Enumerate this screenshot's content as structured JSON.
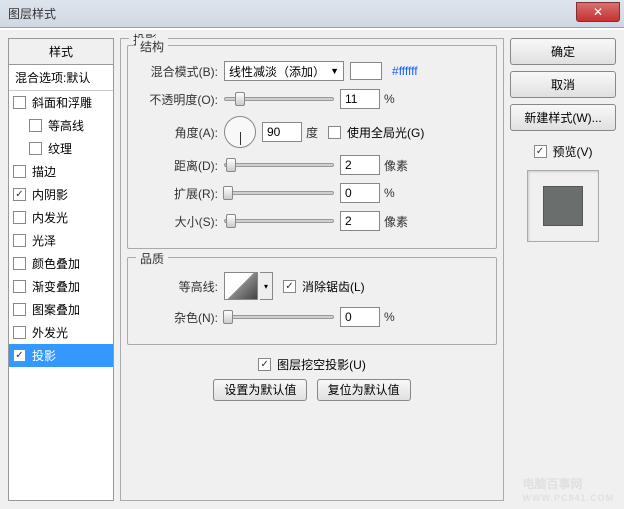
{
  "title": "图层样式",
  "styles_header": "样式",
  "blend_label": "混合选项:默认",
  "styles": [
    {
      "label": "斜面和浮雕",
      "checked": false,
      "indent": false
    },
    {
      "label": "等高线",
      "checked": false,
      "indent": true
    },
    {
      "label": "纹理",
      "checked": false,
      "indent": true
    },
    {
      "label": "描边",
      "checked": false,
      "indent": false
    },
    {
      "label": "内阴影",
      "checked": true,
      "indent": false
    },
    {
      "label": "内发光",
      "checked": false,
      "indent": false
    },
    {
      "label": "光泽",
      "checked": false,
      "indent": false
    },
    {
      "label": "颜色叠加",
      "checked": false,
      "indent": false
    },
    {
      "label": "渐变叠加",
      "checked": false,
      "indent": false
    },
    {
      "label": "图案叠加",
      "checked": false,
      "indent": false
    },
    {
      "label": "外发光",
      "checked": false,
      "indent": false
    },
    {
      "label": "投影",
      "checked": true,
      "indent": false,
      "selected": true
    }
  ],
  "panel": {
    "title": "投影",
    "structure_title": "结构",
    "blend_mode_label": "混合模式(B):",
    "blend_mode_value": "线性减淡（添加）",
    "color_hex": "#ffffff",
    "opacity_label": "不透明度(O):",
    "opacity_value": "11",
    "opacity_unit": "%",
    "angle_label": "角度(A):",
    "angle_value": "90",
    "angle_unit": "度",
    "global_light_label": "使用全局光(G)",
    "global_light_checked": false,
    "distance_label": "距离(D):",
    "distance_value": "2",
    "distance_unit": "像素",
    "spread_label": "扩展(R):",
    "spread_value": "0",
    "spread_unit": "%",
    "size_label": "大小(S):",
    "size_value": "2",
    "size_unit": "像素",
    "quality_title": "品质",
    "contour_label": "等高线:",
    "antialias_label": "消除锯齿(L)",
    "antialias_checked": true,
    "noise_label": "杂色(N):",
    "noise_value": "0",
    "noise_unit": "%",
    "knockout_label": "图层挖空投影(U)",
    "knockout_checked": true,
    "default_set": "设置为默认值",
    "default_reset": "复位为默认值"
  },
  "buttons": {
    "ok": "确定",
    "cancel": "取消",
    "new_style": "新建样式(W)...",
    "preview": "预览(V)"
  },
  "watermark": {
    "main": "电脑百事网",
    "sub": "WWW.PC841.COM"
  }
}
